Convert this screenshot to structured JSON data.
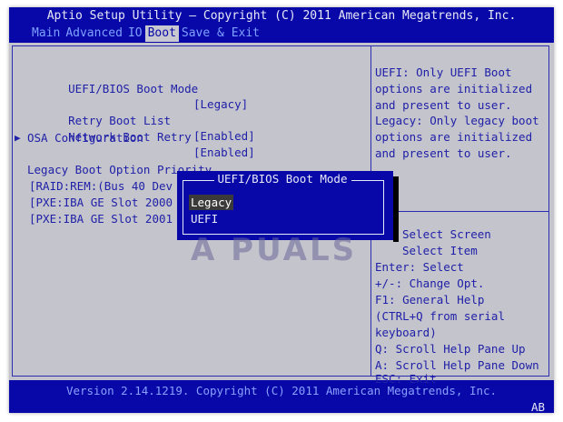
{
  "header": {
    "title": "Aptio Setup Utility – Copyright (C) 2011 American Megatrends, Inc."
  },
  "tabs": [
    {
      "label": "Main",
      "active": false
    },
    {
      "label": "Advanced",
      "active": false
    },
    {
      "label": "IO",
      "active": false
    },
    {
      "label": "Boot",
      "active": true
    },
    {
      "label": "Save & Exit",
      "active": false
    }
  ],
  "settings": {
    "boot_mode": {
      "label": "UEFI/BIOS Boot Mode",
      "value": "[Legacy]"
    },
    "retry_boot_list": {
      "label": "Retry Boot List",
      "value": "[Enabled]"
    },
    "network_boot_retry": {
      "label": "Network Boot Retry",
      "value": "[Enabled]"
    },
    "osa_configuration": {
      "label": "OSA Configuration",
      "marker": "▶"
    },
    "legacy_priority_heading": "Legacy Boot Option Priority",
    "boot_options": [
      "[RAID:REM:(Bus 40 Dev",
      "[PXE:IBA GE Slot 2000",
      "[PXE:IBA GE Slot 2001"
    ]
  },
  "help": {
    "description": "UEFI: Only UEFI Boot options are initialized and present to user. Legacy: Only legacy boot options are initialized and present to user.",
    "keys": [
      "Select Screen",
      "Select Item",
      "Enter: Select",
      "+/-: Change Opt.",
      "F1: General Help",
      "(CTRL+Q from serial",
      "keyboard)",
      "Q: Scroll Help Pane Up",
      "A: Scroll Help Pane Down",
      "ESC: Exit"
    ]
  },
  "popup": {
    "title": "UEFI/BIOS Boot Mode",
    "options": [
      {
        "label": "Legacy",
        "selected": true
      },
      {
        "label": "UEFI",
        "selected": false
      }
    ]
  },
  "watermark": "A  PUALS",
  "footer": {
    "version": "Version 2.14.1219. Copyright (C) 2011 American Megatrends, Inc.",
    "badge": "AB"
  },
  "colors": {
    "bios_blue": "#0808a8",
    "panel_gray": "#c4c4cc",
    "text_blue": "#2020a8",
    "tab_inactive": "#7ea0ff",
    "white_text": "#e8e8f8"
  }
}
